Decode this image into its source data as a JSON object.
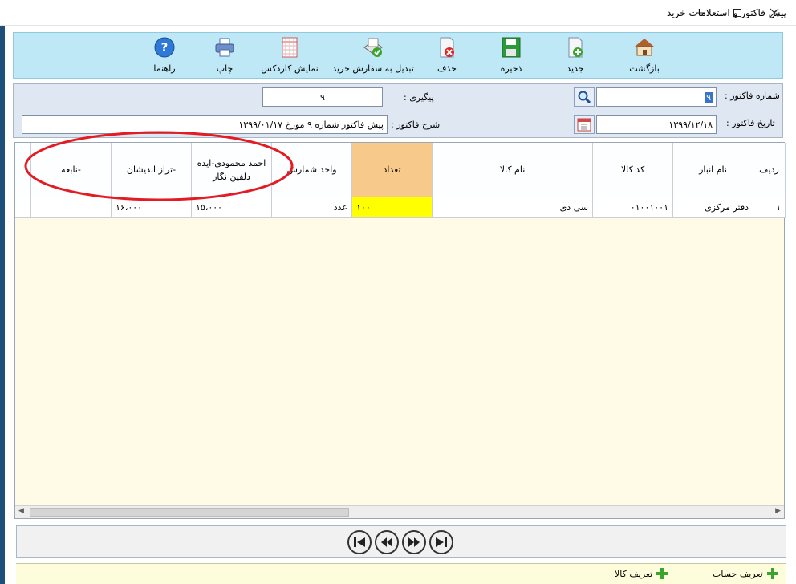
{
  "window": {
    "title": "پیش فاکتور و استعلامات خرید"
  },
  "toolbar": {
    "back": "بازگشت",
    "new": "جدید",
    "save": "ذخیره",
    "delete": "حذف",
    "convert": "تبدیل به سفارش خرید",
    "kardex": "نمایش کاردکس",
    "print": "چاپ",
    "help": "راهنما"
  },
  "form": {
    "invoice_number_label": "شماره فاکتور :",
    "invoice_number_value": "۹",
    "followup_label": "پیگیری :",
    "followup_value": "۹",
    "invoice_date_label": "تاریخ فاکتور :",
    "invoice_date_value": "۱۳۹۹/۱۲/۱۸",
    "description_label": "شرح فاکتور :",
    "description_value": "پیش فاکتور شماره ۹ مورخ ۱۳۹۹/۰۱/۱۷"
  },
  "grid": {
    "headers": {
      "row": "ردیف",
      "warehouse": "نام انبار",
      "code": "کد کالا",
      "name": "نام کالا",
      "qty": "تعداد",
      "unit": "واحد شمارش",
      "vendor1": "احمد محمودی-ایده دلفین نگار",
      "vendor2": "-تراز اندیشان",
      "vendor3": "-نابغه"
    },
    "rows": [
      {
        "row": "۱",
        "warehouse": "دفتر مرکزی",
        "code": "۰۱۰۰۱۰۰۱",
        "name": "سی دی",
        "qty": "۱۰۰",
        "unit": "عدد",
        "vendor1": "۱۵،۰۰۰",
        "vendor2": "۱۶،۰۰۰",
        "vendor3": ""
      }
    ]
  },
  "bottom": {
    "define_account": "تعریف حساب",
    "define_item": "تعریف کالا"
  },
  "colors": {
    "toolbar_bg": "#bfe8f7",
    "grid_bg": "#fffbe6",
    "active_header": "#f7c98a",
    "qty_cell": "#ffff00",
    "annotation": "#e31b23"
  }
}
